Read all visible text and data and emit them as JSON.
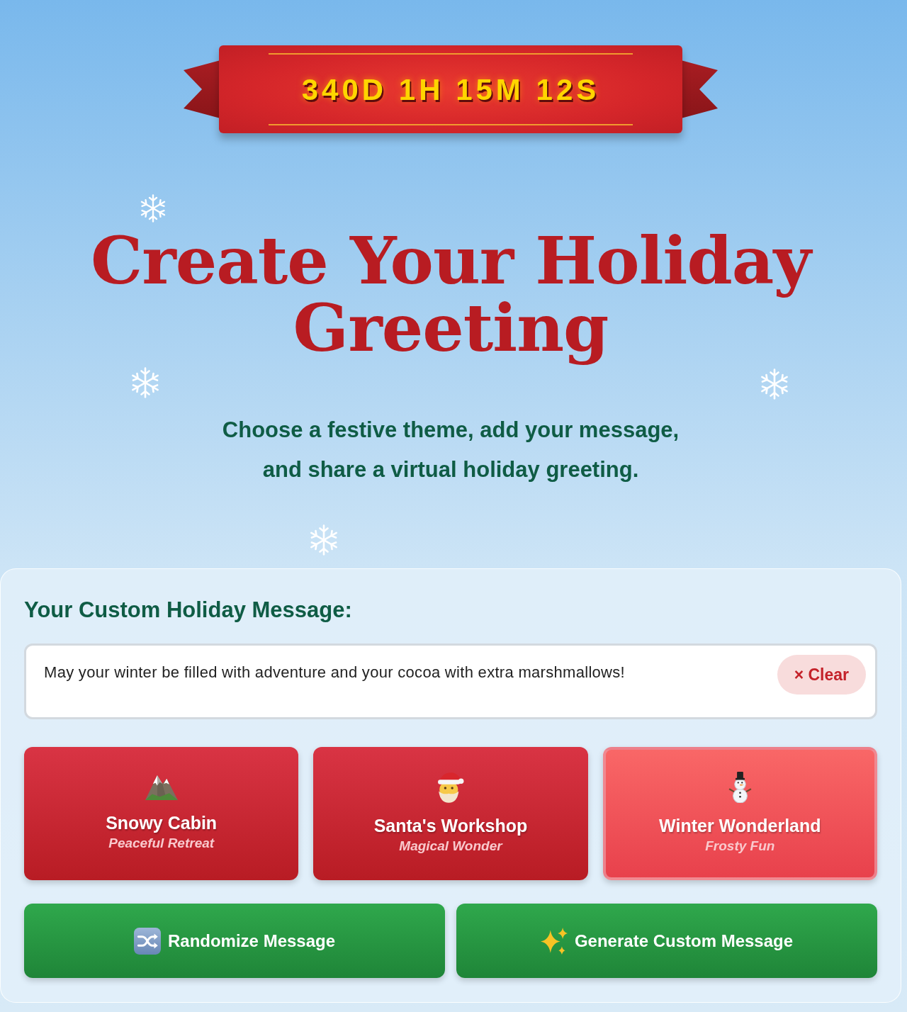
{
  "countdown": {
    "text": "340D 1H 15M 12S"
  },
  "title": "Create Your Holiday Greeting",
  "subtitle": "Choose a festive theme, add your message, and share a virtual holiday greeting.",
  "message_panel": {
    "heading": "Your Custom Holiday Message:",
    "message_field": {
      "value": "May your winter be filled with adventure and your cocoa with extra marshmallows!"
    },
    "clear_button": {
      "label": "× Clear"
    }
  },
  "themes": [
    {
      "kind": "mountain",
      "name": "Snowy Cabin",
      "tagline": "Peaceful Retreat",
      "selected": false
    },
    {
      "kind": "santa",
      "name": "Santa's Workshop",
      "tagline": "Magical Wonder",
      "selected": false
    },
    {
      "kind": "snowman",
      "name": "Winter Wonderland",
      "tagline": "Frosty Fun",
      "selected": true
    }
  ],
  "actions": [
    {
      "kind": "shuffle",
      "label": "Randomize Message"
    },
    {
      "kind": "sparkles",
      "label": "Generate Custom Message"
    }
  ]
}
